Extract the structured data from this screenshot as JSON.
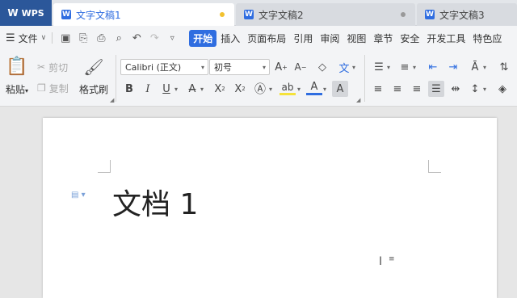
{
  "app": {
    "logo_text": "WPS",
    "brand_color": "#2b579a",
    "accent_color": "#2f6de0"
  },
  "tabs": [
    {
      "label": "文字文稿1",
      "state": "active",
      "modified_dot_color": "#f2c12e"
    },
    {
      "label": "文字文稿2",
      "state": "inactive",
      "modified_dot_color": "#999999"
    },
    {
      "label": "文字文稿3",
      "state": "inactive"
    }
  ],
  "menubar": {
    "file_label": "文件",
    "quick_icons": [
      "save-icon",
      "save-as-icon",
      "print-icon",
      "print-preview-icon",
      "undo-icon",
      "redo-icon",
      "customize-icon"
    ],
    "items": [
      "开始",
      "插入",
      "页面布局",
      "引用",
      "审阅",
      "视图",
      "章节",
      "安全",
      "开发工具",
      "特色应"
    ],
    "active_item": "开始"
  },
  "ribbon": {
    "paste_label": "粘贴",
    "cut_label": "剪切",
    "copy_label": "复制",
    "format_painter_label": "格式刷",
    "font_name": "Calibri (正文)",
    "font_size": "初号"
  },
  "document": {
    "title": "文档 1"
  }
}
